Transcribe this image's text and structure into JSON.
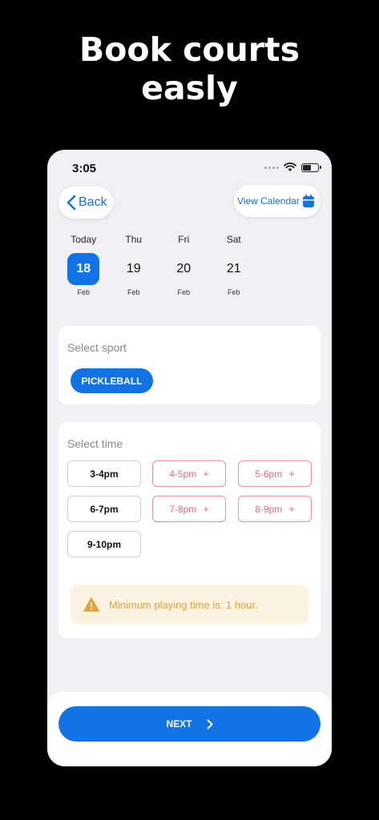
{
  "marketing": {
    "headline_line1": "Book courts",
    "headline_line2": "easly"
  },
  "status_bar": {
    "time": "3:05"
  },
  "header": {
    "back_label": "Back",
    "calendar_label": "View Calendar"
  },
  "days": [
    {
      "name": "Today",
      "date": "18",
      "month": "Feb",
      "selected": true
    },
    {
      "name": "Thu",
      "date": "19",
      "month": "Feb",
      "selected": false
    },
    {
      "name": "Fri",
      "date": "20",
      "month": "Feb",
      "selected": false
    },
    {
      "name": "Sat",
      "date": "21",
      "month": "Feb",
      "selected": false
    }
  ],
  "sport_section": {
    "title": "Select sport",
    "selected_sport": "PICKLEBALL"
  },
  "time_section": {
    "title": "Select time",
    "slots": [
      {
        "label": "3-4pm",
        "available": true
      },
      {
        "label": "4-5pm",
        "available": false
      },
      {
        "label": "5-6pm",
        "available": false
      },
      {
        "label": "6-7pm",
        "available": true
      },
      {
        "label": "7-8pm",
        "available": false
      },
      {
        "label": "8-9pm",
        "available": false
      },
      {
        "label": "9-10pm",
        "available": true
      }
    ],
    "unavailable_icon": "plus-icon"
  },
  "notice": {
    "icon": "warning-icon",
    "text": "Minimum playing time is: 1 hour."
  },
  "footer": {
    "next_label": "NEXT"
  },
  "colors": {
    "accent": "#1273e6",
    "unavailable": "#e56b78",
    "warning": "#e5a235",
    "warning_bg": "#fcf3e3"
  }
}
